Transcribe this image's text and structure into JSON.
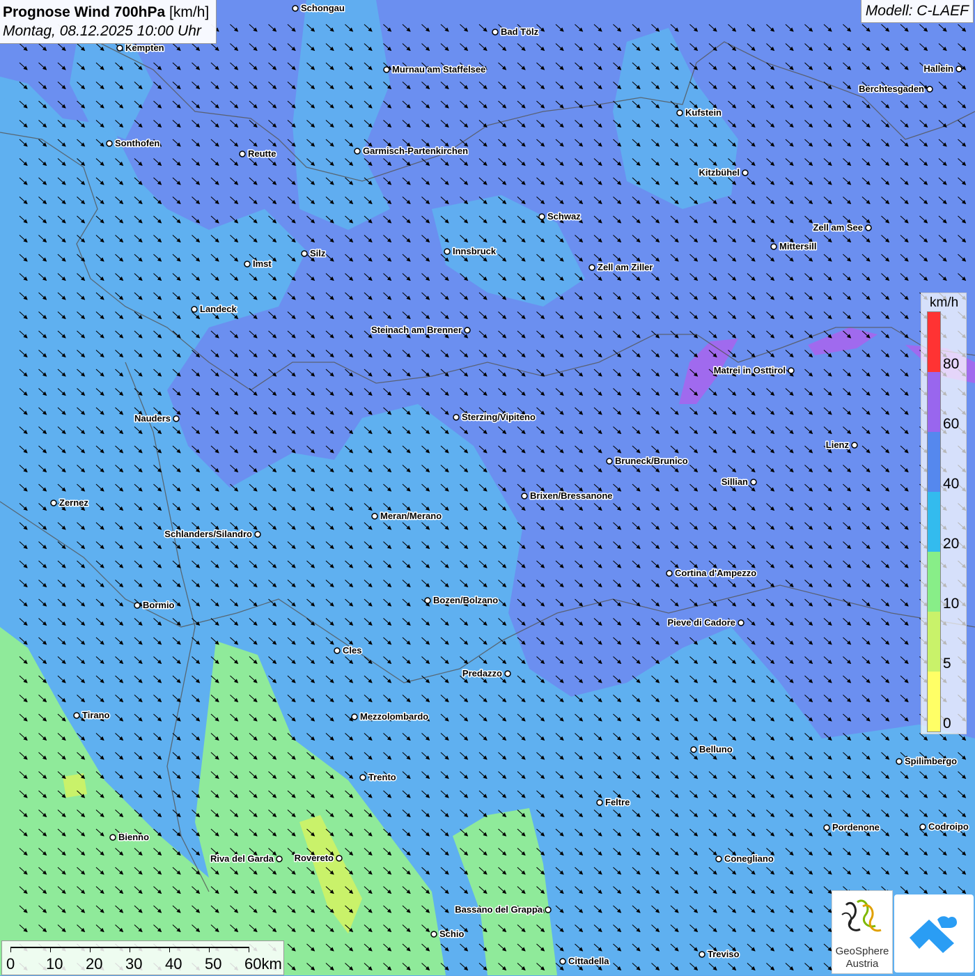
{
  "title": {
    "main": "Prognose Wind 700hPa",
    "unit": "[km/h]",
    "datetime": "Montag, 08.12.2025 10:00 Uhr"
  },
  "model": "Modell: C-LAEF",
  "legend": {
    "unit": "km/h",
    "classes": [
      {
        "label": "0",
        "color": "#ffff66"
      },
      {
        "label": "5",
        "color": "#c9f26a"
      },
      {
        "label": "10",
        "color": "#88ee88"
      },
      {
        "label": "20",
        "color": "#33bbee"
      },
      {
        "label": "40",
        "color": "#5588ee"
      },
      {
        "label": "60",
        "color": "#9966ee"
      },
      {
        "label": "80",
        "color": "#ff3333"
      }
    ]
  },
  "scalebar": {
    "labels": [
      "0",
      "10",
      "20",
      "30",
      "40",
      "50",
      "60km"
    ]
  },
  "logos": {
    "geosphere_line1": "GeoSphere",
    "geosphere_line2": "Austria"
  },
  "cities": [
    {
      "name": "Schongau"
    },
    {
      "name": "Bad Tölz"
    },
    {
      "name": "Kempten"
    },
    {
      "name": "Murnau am Staffelsee"
    },
    {
      "name": "Hallein"
    },
    {
      "name": "Berchtesgaden"
    },
    {
      "name": "Kufstein"
    },
    {
      "name": "Sonthofen"
    },
    {
      "name": "Reutte"
    },
    {
      "name": "Garmisch-Partenkirchen"
    },
    {
      "name": "Kitzbühel"
    },
    {
      "name": "Schwaz"
    },
    {
      "name": "Zell am See"
    },
    {
      "name": "Mittersill"
    },
    {
      "name": "Innsbruck"
    },
    {
      "name": "Silz"
    },
    {
      "name": "Imst"
    },
    {
      "name": "Zell am Ziller"
    },
    {
      "name": "Landeck"
    },
    {
      "name": "Steinach am Brenner"
    },
    {
      "name": "Matrei in Osttirol"
    },
    {
      "name": "Nauders"
    },
    {
      "name": "Sterzing/Vipiteno"
    },
    {
      "name": "Lienz"
    },
    {
      "name": "Bruneck/Brunico"
    },
    {
      "name": "Sillian"
    },
    {
      "name": "Zernez"
    },
    {
      "name": "Brixen/Bressanone"
    },
    {
      "name": "Meran/Merano"
    },
    {
      "name": "Schlanders/Silandro"
    },
    {
      "name": "Cortina d'Ampezzo"
    },
    {
      "name": "Bozen/Bolzano"
    },
    {
      "name": "Bormio"
    },
    {
      "name": "Pieve di Cadore"
    },
    {
      "name": "Cles"
    },
    {
      "name": "Predazzo"
    },
    {
      "name": "Tirano"
    },
    {
      "name": "Mezzolombardo"
    },
    {
      "name": "Belluno"
    },
    {
      "name": "Spilimbergo"
    },
    {
      "name": "Trento"
    },
    {
      "name": "Feltre"
    },
    {
      "name": "Pordenone"
    },
    {
      "name": "Codroipo"
    },
    {
      "name": "Bienno"
    },
    {
      "name": "Riva del Garda"
    },
    {
      "name": "Rovereto"
    },
    {
      "name": "Conegliano"
    },
    {
      "name": "Bassano del Grappa"
    },
    {
      "name": "Schio"
    },
    {
      "name": "Treviso"
    },
    {
      "name": "Cittadella"
    }
  ],
  "wind_field": {
    "direction": "from northwest",
    "dominant_speed_class_kmh": "20-40",
    "strong_areas_kmh": "40-60",
    "weak_areas_kmh": "10-20"
  }
}
